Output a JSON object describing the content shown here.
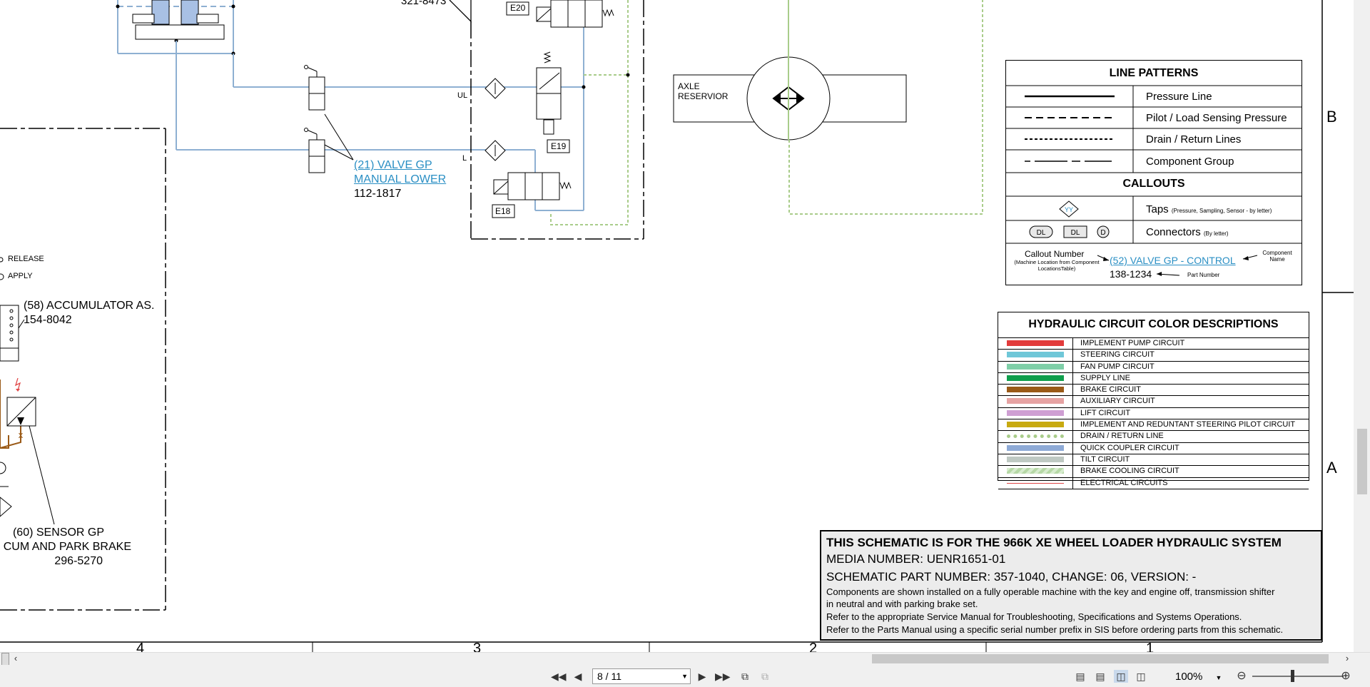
{
  "schematic": {
    "top_partial_number": "321-8473",
    "connectors": {
      "e20": "E20",
      "e19": "E19",
      "e18": "E18"
    },
    "ports": {
      "ul": "UL",
      "l": "L"
    },
    "axle_reservoir": {
      "line1": "AXLE",
      "line2": "RESERVIOR"
    },
    "valve_manual_lower": {
      "name_line1": "(21) VALVE GP",
      "name_line2": "MANUAL LOWER",
      "part": "112-1817"
    },
    "release_label": "RELEASE",
    "apply_label": "APPLY",
    "accumulator": {
      "name": "(58) ACCUMULATOR AS.",
      "part": "154-8042"
    },
    "sensor": {
      "line1": "(60) SENSOR GP",
      "line2": "CUM AND PARK BRAKE",
      "part": "296-5270"
    },
    "zone_letters": {
      "b": "B",
      "a": "A"
    },
    "zone_numbers": [
      "4",
      "3",
      "2",
      "1"
    ]
  },
  "line_patterns": {
    "title": "LINE PATTERNS",
    "rows": [
      "Pressure Line",
      "Pilot / Load Sensing Pressure",
      "Drain / Return Lines",
      "Component Group"
    ],
    "callouts_title": "CALLOUTS",
    "taps_label": "Taps",
    "taps_note": "(Pressure, Sampling, Sensor - by letter)",
    "taps_symbol": "YY",
    "connectors_label": "Connectors",
    "connectors_note": "(By letter)",
    "connector_symbols": [
      "DL",
      "DL",
      "D"
    ],
    "callout_number_label": "Callout Number",
    "callout_number_note": "(Machine Location from Component LocationsTable)",
    "example_callout": "(52) VALVE GP - CONTROL",
    "example_part": "138-1234",
    "component_name_label": "Component Name",
    "part_number_label": "Part Number"
  },
  "color_descriptions": {
    "title": "HYDRAULIC CIRCUIT COLOR DESCRIPTIONS",
    "rows": [
      {
        "label": "IMPLEMENT PUMP CIRCUIT",
        "color": "#e23b3b",
        "style": "solid"
      },
      {
        "label": "STEERING CIRCUIT",
        "color": "#6fc7d8",
        "style": "solid"
      },
      {
        "label": "FAN PUMP CIRCUIT",
        "color": "#7fcfa8",
        "style": "solid"
      },
      {
        "label": "SUPPLY LINE",
        "color": "#0f9e4c",
        "style": "solid"
      },
      {
        "label": "BRAKE CIRCUIT",
        "color": "#9a5a17",
        "style": "solid"
      },
      {
        "label": "AUXILIARY CIRCUIT",
        "color": "#e6a3a3",
        "style": "solid"
      },
      {
        "label": "LIFT CIRCUIT",
        "color": "#cf9fd3",
        "style": "solid"
      },
      {
        "label": "IMPLEMENT AND REDUNTANT STEERING PILOT CIRCUIT",
        "color": "#c8aa10",
        "style": "solid"
      },
      {
        "label": "DRAIN / RETURN LINE",
        "color": "#a9cc8a",
        "style": "dotted"
      },
      {
        "label": "QUICK COUPLER CIRCUIT",
        "color": "#8eaad6",
        "style": "solid"
      },
      {
        "label": "TILT CIRCUIT",
        "color": "#bfc9c3",
        "style": "solid"
      },
      {
        "label": "BRAKE COOLING CIRCUIT",
        "color": "#b6d8a6",
        "style": "hatched"
      },
      {
        "label": "ELECTRICAL CIRCUITS",
        "color": "#e04848",
        "style": "thin"
      }
    ]
  },
  "title_block": {
    "heading": "THIS SCHEMATIC IS FOR THE 966K XE WHEEL LOADER HYDRAULIC SYSTEM",
    "media": "MEDIA NUMBER: UENR1651-01",
    "part": "SCHEMATIC PART NUMBER: 357-1040, CHANGE: 06, VERSION: -",
    "note1a": "Components are shown installed on a fully operable machine with the key and engine off, transmission shifter",
    "note1b": "in neutral and with parking brake set.",
    "note2": "Refer to the appropriate Service Manual for Troubleshooting, Specifications and Systems Operations.",
    "note3": "Refer to the Parts Manual using a specific serial number prefix in SIS before ordering parts from this schematic."
  },
  "toolbar": {
    "page_value": "8 / 11",
    "zoom": "100%"
  },
  "icons": [
    "first-page-icon",
    "prev-page-icon",
    "next-page-icon",
    "last-page-icon",
    "prev-view-icon",
    "next-view-icon",
    "single-page-icon",
    "continuous-icon",
    "two-page-icon",
    "two-page-continuous-icon",
    "zoom-out-icon",
    "zoom-in-icon",
    "scroll-left-icon",
    "scroll-right-icon"
  ],
  "colors": {
    "hydraulic_line": "#8eb0d2",
    "drain_line": "#a9cc8a",
    "link": "#2a8fc4",
    "title_block_bg": "#ececec"
  }
}
